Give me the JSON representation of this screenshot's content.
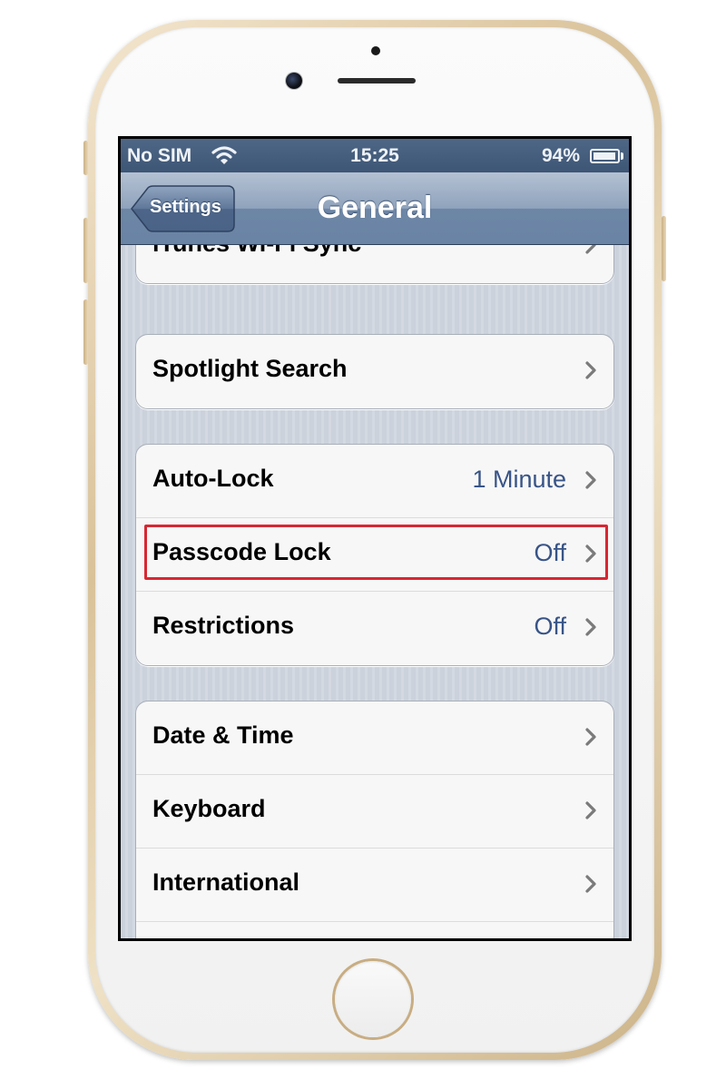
{
  "status_bar": {
    "carrier": "No SIM",
    "time": "15:25",
    "battery_percent": "94%",
    "battery_level": 0.94
  },
  "nav_bar": {
    "back_label": "Settings",
    "title": "General"
  },
  "groups": [
    {
      "rows": [
        {
          "label": "iTunes Wi-Fi Sync",
          "value": ""
        }
      ]
    },
    {
      "rows": [
        {
          "label": "Spotlight Search",
          "value": ""
        }
      ]
    },
    {
      "rows": [
        {
          "label": "Auto-Lock",
          "value": "1 Minute"
        },
        {
          "label": "Passcode Lock",
          "value": "Off",
          "highlighted": true
        },
        {
          "label": "Restrictions",
          "value": "Off"
        }
      ]
    },
    {
      "rows": [
        {
          "label": "Date & Time",
          "value": ""
        },
        {
          "label": "Keyboard",
          "value": ""
        },
        {
          "label": "International",
          "value": ""
        },
        {
          "label": "",
          "value": ""
        }
      ]
    }
  ],
  "colors": {
    "highlight_border": "#d72732",
    "value_text": "#385487",
    "phone_frame": "gold"
  },
  "icons": [
    "wifi-icon",
    "battery-icon",
    "chevron-right-icon",
    "back-arrow-icon"
  ]
}
